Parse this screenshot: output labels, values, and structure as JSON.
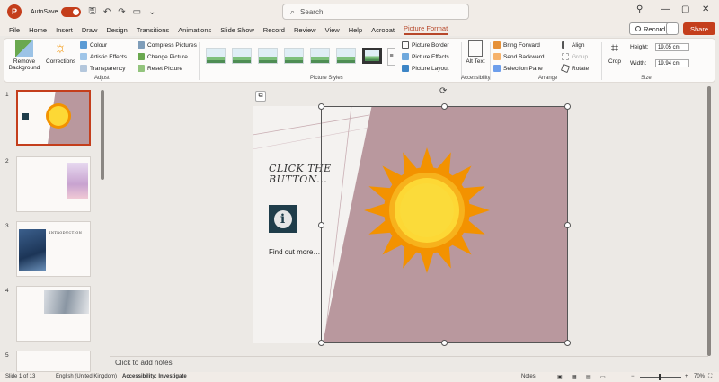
{
  "titlebar": {
    "app_logo": "P",
    "autosave_label": "AutoSave",
    "autosave_state": "on",
    "search_placeholder": "Search"
  },
  "menu": {
    "tabs": [
      "File",
      "Home",
      "Insert",
      "Draw",
      "Design",
      "Transitions",
      "Animations",
      "Slide Show",
      "Record",
      "Review",
      "View",
      "Help",
      "Acrobat",
      "Picture Format"
    ],
    "active_tab": "Picture Format",
    "record_label": "Record",
    "share_label": "Share"
  },
  "ribbon": {
    "remove_background": "Remove Background",
    "corrections": "Corrections",
    "colour": "Colour",
    "artistic_effects": "Artistic Effects",
    "transparency": "Transparency",
    "compress_pictures": "Compress Pictures",
    "change_picture": "Change Picture",
    "reset_picture": "Reset Picture",
    "group_adjust": "Adjust",
    "group_picture_styles": "Picture Styles",
    "picture_border": "Picture Border",
    "picture_effects": "Picture Effects",
    "picture_layout": "Picture Layout",
    "alt_text": "Alt Text",
    "group_accessibility": "Accessibility",
    "bring_forward": "Bring Forward",
    "send_backward": "Send Backward",
    "selection_pane": "Selection Pane",
    "align": "Align",
    "group": "Group",
    "rotate": "Rotate",
    "group_arrange": "Arrange",
    "crop": "Crop",
    "height_label": "Height:",
    "height_value": "19.05 cm",
    "width_label": "Width:",
    "width_value": "19.94 cm",
    "group_size": "Size"
  },
  "thumbnails": {
    "numbers": [
      "1",
      "2",
      "3",
      "4",
      "5"
    ],
    "slide3_heading": "INTRODUCTION",
    "slide1_text": "CLICK THE BUTTON"
  },
  "slide": {
    "title": "CLICK THE BUTTON...",
    "info_glyph": "i",
    "find_more": "Find out more…"
  },
  "notes_placeholder": "Click to add notes",
  "statusbar": {
    "slide_info": "Slide 1 of 13",
    "language": "English (United Kingdom)",
    "accessibility": "Accessibility: Investigate",
    "notes": "Notes",
    "zoom": "70%"
  },
  "colors": {
    "accent": "#c43e1c",
    "slide_shape": "#b9989e",
    "info_button": "#1f3d4a",
    "sun_outer": "#f39200",
    "sun_inner": "#fdd835"
  }
}
